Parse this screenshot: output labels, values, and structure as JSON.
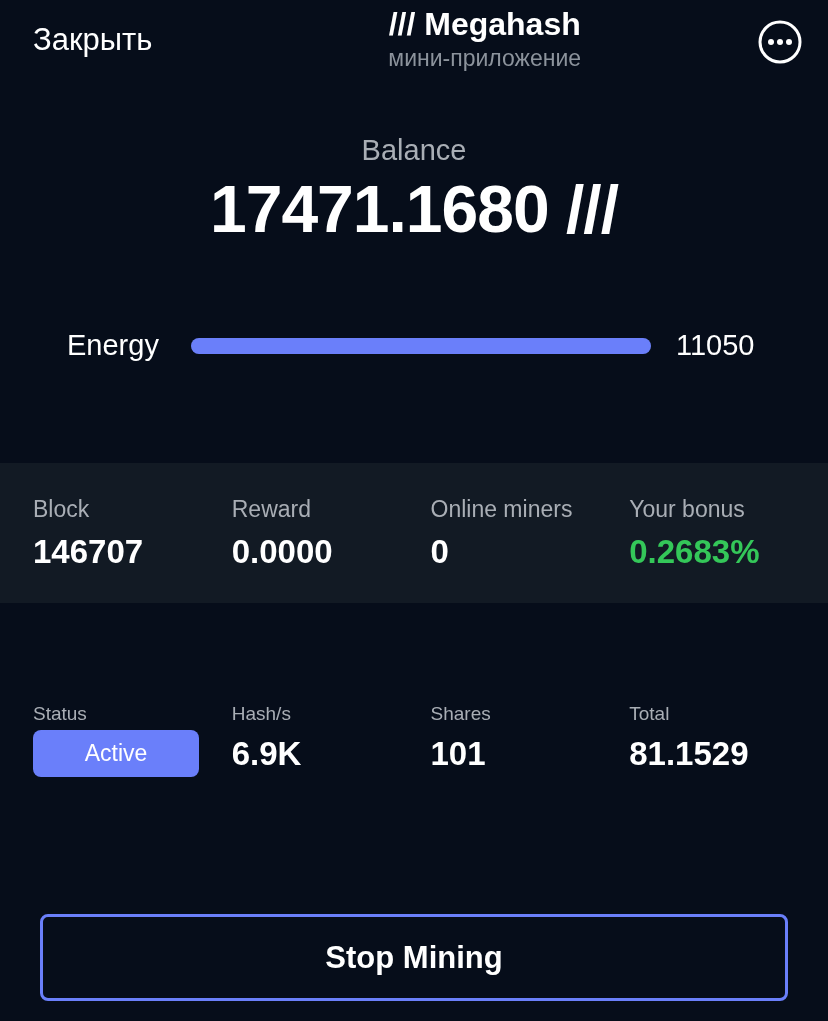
{
  "header": {
    "close": "Закрыть",
    "title": "/// Megahash",
    "subtitle": "мини-приложение"
  },
  "balance": {
    "label": "Balance",
    "value": "17471.1680 ///"
  },
  "energy": {
    "label": "Energy",
    "level": 1,
    "reading": "11050"
  },
  "block_stats": [
    {
      "label": "Block",
      "value": "146707",
      "color": "#ffffff"
    },
    {
      "label": "Reward",
      "value": "0.0000",
      "color": "#ffffff"
    },
    {
      "label": "Online miners",
      "value": "0",
      "color": "#ffffff"
    },
    {
      "label": "Your bonus",
      "value": "0.2683%",
      "color": "#34c759"
    }
  ],
  "mining_stats": [
    {
      "kind": "badge",
      "label": "Status",
      "value": "Active"
    },
    {
      "kind": "text",
      "label": "Hash/s",
      "value": "6.9K"
    },
    {
      "kind": "text",
      "label": "Shares",
      "value": "101"
    },
    {
      "kind": "text",
      "label": "Total",
      "value": "81.1529"
    }
  ],
  "action_button": "Stop Mining"
}
